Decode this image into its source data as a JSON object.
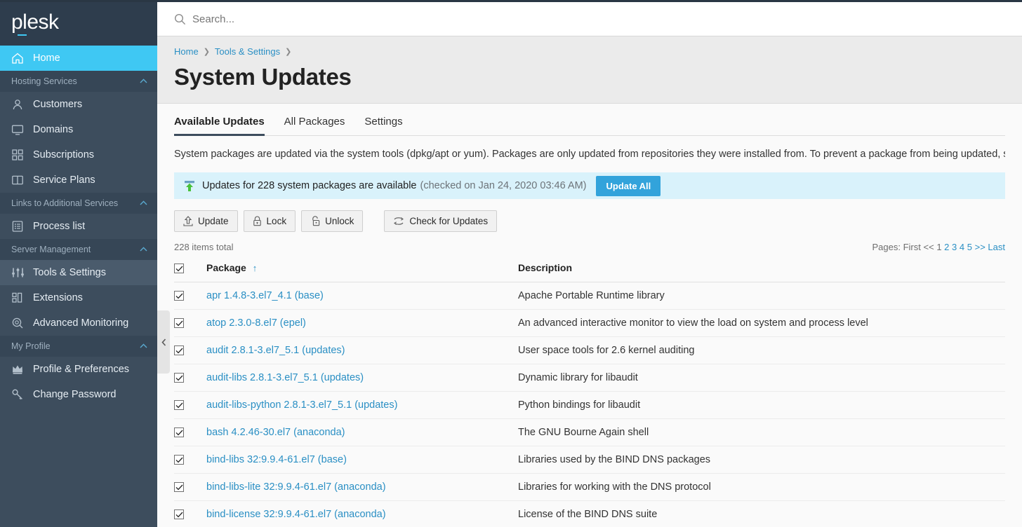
{
  "brand": {
    "name": "plesk"
  },
  "search": {
    "placeholder": "Search...",
    "value": "",
    "icon": "search-icon"
  },
  "breadcrumb": {
    "items": [
      {
        "label": "Home"
      },
      {
        "label": "Tools & Settings"
      }
    ]
  },
  "page": {
    "title": "System Updates"
  },
  "sidebar": {
    "items": [
      {
        "type": "item",
        "label": "Home",
        "icon": "home-icon",
        "state": "active"
      },
      {
        "type": "group",
        "label": "Hosting Services",
        "icon": "chevron-up-icon"
      },
      {
        "type": "item",
        "label": "Customers",
        "icon": "user-icon"
      },
      {
        "type": "item",
        "label": "Domains",
        "icon": "monitor-icon"
      },
      {
        "type": "item",
        "label": "Subscriptions",
        "icon": "grid-icon"
      },
      {
        "type": "item",
        "label": "Service Plans",
        "icon": "book-icon"
      },
      {
        "type": "group",
        "label": "Links to Additional Services",
        "icon": "chevron-up-icon"
      },
      {
        "type": "item",
        "label": "Process list",
        "icon": "list-icon"
      },
      {
        "type": "group",
        "label": "Server Management",
        "icon": "chevron-up-icon"
      },
      {
        "type": "item",
        "label": "Tools & Settings",
        "icon": "sliders-icon",
        "state": "selected"
      },
      {
        "type": "item",
        "label": "Extensions",
        "icon": "blocks-icon"
      },
      {
        "type": "item",
        "label": "Advanced Monitoring",
        "icon": "magnifier-gauge-icon"
      },
      {
        "type": "group",
        "label": "My Profile",
        "icon": "chevron-up-icon"
      },
      {
        "type": "item",
        "label": "Profile & Preferences",
        "icon": "crown-icon"
      },
      {
        "type": "item",
        "label": "Change Password",
        "icon": "key-icon"
      }
    ],
    "collapse_handle": "collapse-sidebar-icon"
  },
  "tabs": [
    {
      "label": "Available Updates",
      "active": true
    },
    {
      "label": "All Packages",
      "active": false
    },
    {
      "label": "Settings",
      "active": false
    }
  ],
  "intro": "System packages are updated via the system tools (dpkg/apt or yum). Packages are only updated from repositories they were installed from. To prevent a package from being updated, se",
  "banner": {
    "icon": "upload-green-icon",
    "message": "Updates for 228 system packages are available",
    "checked": "(checked on Jan 24, 2020 03:46 AM)",
    "button": "Update All",
    "accent": "#32a3db",
    "background": "#d9f2fb"
  },
  "toolbar": {
    "update_label": "Update",
    "update_icon": "upload-box-icon",
    "lock_label": "Lock",
    "lock_icon": "lock-closed-icon",
    "unlock_label": "Unlock",
    "unlock_icon": "lock-open-icon",
    "check_label": "Check for Updates",
    "check_icon": "refresh-icon"
  },
  "list": {
    "total": "228 items total",
    "pager": {
      "label": "Pages:",
      "first": "First",
      "prev": "<<",
      "pages": [
        "1",
        "2",
        "3",
        "4",
        "5"
      ],
      "current": "1",
      "next": ">>",
      "last": "Last"
    },
    "columns": {
      "package": "Package",
      "description": "Description",
      "sort_icon": "sort-ascending-icon"
    },
    "select_all_checked": true,
    "rows": [
      {
        "checked": true,
        "package": "apr 1.4.8-3.el7_4.1 (base)",
        "description": "Apache Portable Runtime library"
      },
      {
        "checked": true,
        "package": "atop 2.3.0-8.el7 (epel)",
        "description": "An advanced interactive monitor to view the load on system and process level"
      },
      {
        "checked": true,
        "package": "audit 2.8.1-3.el7_5.1 (updates)",
        "description": "User space tools for 2.6 kernel auditing"
      },
      {
        "checked": true,
        "package": "audit-libs 2.8.1-3.el7_5.1 (updates)",
        "description": "Dynamic library for libaudit"
      },
      {
        "checked": true,
        "package": "audit-libs-python 2.8.1-3.el7_5.1 (updates)",
        "description": "Python bindings for libaudit"
      },
      {
        "checked": true,
        "package": "bash 4.2.46-30.el7 (anaconda)",
        "description": "The GNU Bourne Again shell"
      },
      {
        "checked": true,
        "package": "bind-libs 32:9.9.4-61.el7 (base)",
        "description": "Libraries used by the BIND DNS packages"
      },
      {
        "checked": true,
        "package": "bind-libs-lite 32:9.9.4-61.el7 (anaconda)",
        "description": "Libraries for working with the DNS protocol"
      },
      {
        "checked": true,
        "package": "bind-license 32:9.9.4-61.el7 (anaconda)",
        "description": "License of the BIND DNS suite"
      }
    ]
  },
  "colors": {
    "sidebar_bg": "#3d4d5d",
    "sidebar_header_bg": "#2e3d4d",
    "accent_cyan": "#3fc8f3",
    "link_blue": "#2a8fc4",
    "page_head_bg": "#ebebeb"
  }
}
